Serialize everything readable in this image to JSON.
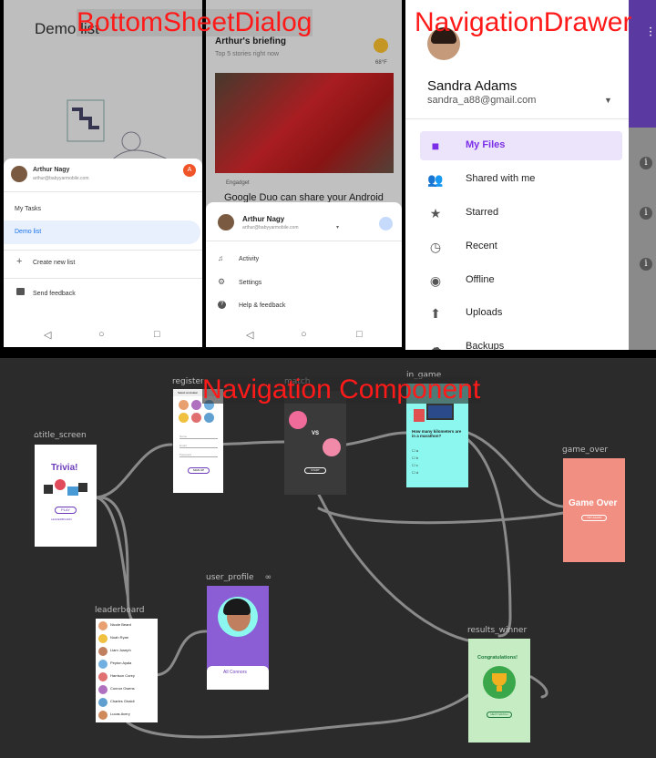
{
  "titles": {
    "bottom_sheet": "BottomSheetDialog",
    "nav_drawer": "NavigationDrawer",
    "nav_component": "Navigation Component"
  },
  "panel1": {
    "bg_title": "Demo list",
    "account_name": "Arthur Nagy",
    "account_email": "arthur@babyyarmobile.com",
    "avatar_letter": "A",
    "items": [
      "My Tasks",
      "Demo list",
      "Create new list",
      "Send feedback"
    ]
  },
  "panel2": {
    "briefing_title": "Arthur's briefing",
    "briefing_sub": "Top 5 stories right now",
    "temp": "68°F",
    "source": "Engadget",
    "headline": "Google Duo can share your Android",
    "account_name": "Arthur Nagy",
    "account_email": "arthur@babyyarmobile.com",
    "items": [
      "Activity",
      "Settings",
      "Help & feedback"
    ]
  },
  "drawer": {
    "name": "Sandra Adams",
    "email": "sandra_a88@gmail.com",
    "items": [
      {
        "label": "My Files",
        "icon": "folder-icon",
        "active": true
      },
      {
        "label": "Shared with me",
        "icon": "people-icon",
        "active": false
      },
      {
        "label": "Starred",
        "icon": "star-icon",
        "active": false
      },
      {
        "label": "Recent",
        "icon": "clock-icon",
        "active": false
      },
      {
        "label": "Offline",
        "icon": "offline-icon",
        "active": false
      },
      {
        "label": "Uploads",
        "icon": "upload-icon",
        "active": false
      },
      {
        "label": "Backups",
        "icon": "backup-icon",
        "active": false
      }
    ]
  },
  "graph": {
    "nodes": {
      "title_screen": "title_screen",
      "register": "register",
      "match": "match",
      "in_game": "in_game",
      "game_over": "game_over",
      "user_profile": "user_profile",
      "leaderboard": "leaderboard",
      "results_winner": "results_winner"
    },
    "trivia_title": "Trivia!",
    "play": "PLAY",
    "leaderboard_link": "LEADERBOARD",
    "register_header": "Select an Avatar",
    "register_fields": [
      "Name",
      "Email",
      "Password"
    ],
    "sign_up": "SIGN UP",
    "vs": "VS",
    "start": "START",
    "question": "How many kilometers are in a marathon?",
    "game_over_title": "Game Over",
    "try_again": "TRY AGAIN",
    "profile_name": "All Connors",
    "winner_title": "Congratulations!",
    "next_match": "NEXT MATCH",
    "leaders": [
      "Nicole Beard",
      "Noah Ryan",
      "Liam Joseph",
      "Peyton Ayala",
      "Harrison Corey",
      "Connor Owens",
      "Charles Giraldi",
      "Lucas Avery"
    ]
  },
  "colors": {
    "accent_purple": "#7a2ee8",
    "title_red": "#ff1a1a",
    "graph_bg": "#2b2b2b",
    "game_over": "#f08f82",
    "in_game": "#8bf7ee",
    "winner": "#c6ecc4",
    "profile": "#8b5ed6"
  }
}
